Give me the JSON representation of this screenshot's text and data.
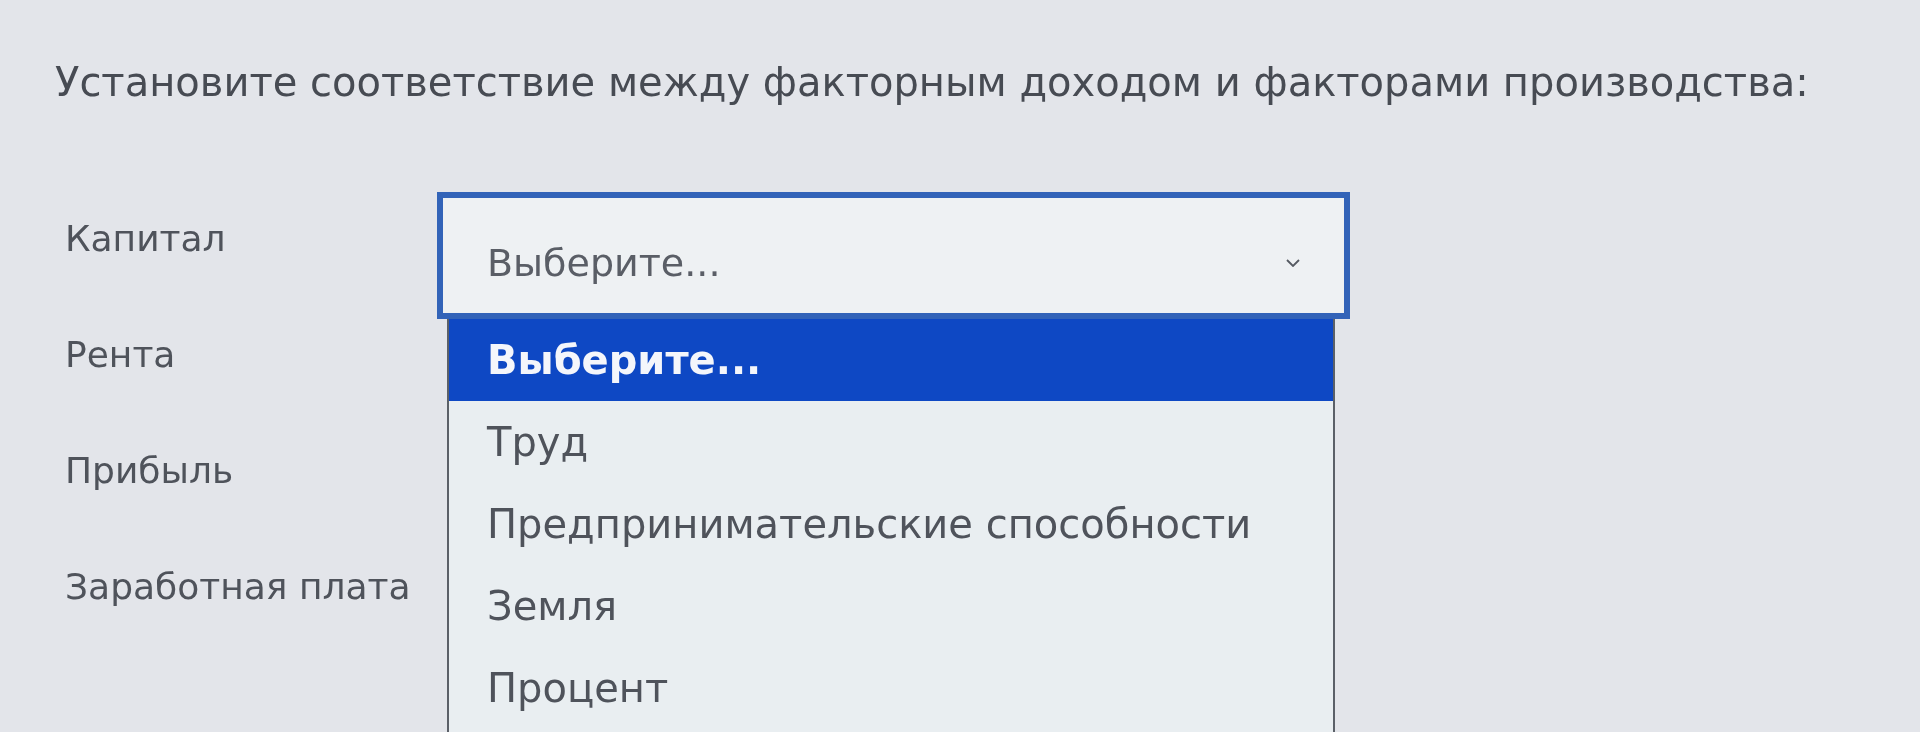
{
  "question": {
    "text": "Установите соответствие между факторным доходом и факторами производства:"
  },
  "rows": [
    {
      "label": "Капитал",
      "select": {
        "value": "Выберите...",
        "open": true
      }
    },
    {
      "label": "Рента"
    },
    {
      "label": "Прибыль"
    },
    {
      "label": "Заработная плата"
    }
  ],
  "dropdown": {
    "options": [
      {
        "label": "Выберите...",
        "selected": true
      },
      {
        "label": "Труд",
        "selected": false
      },
      {
        "label": "Предпринимательские способности",
        "selected": false
      },
      {
        "label": "Земля",
        "selected": false
      },
      {
        "label": "Процент",
        "selected": false
      }
    ]
  }
}
